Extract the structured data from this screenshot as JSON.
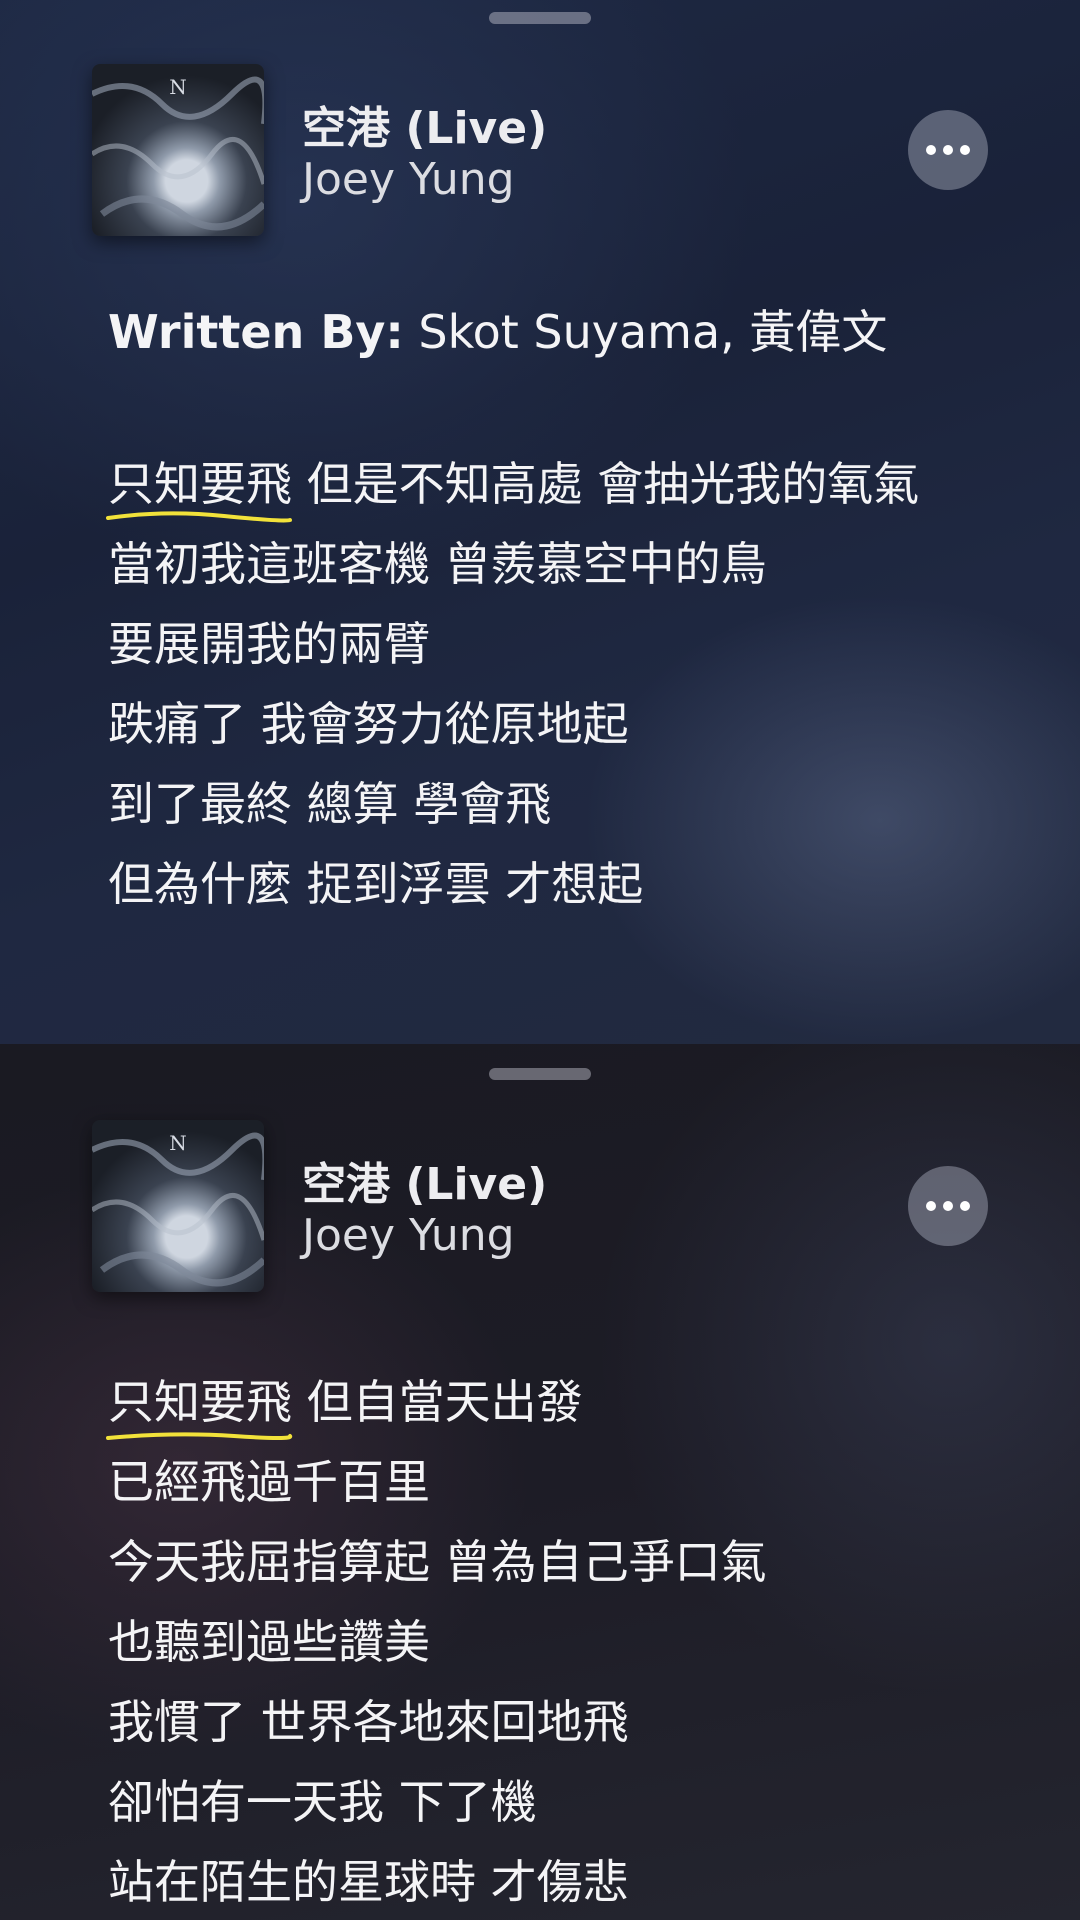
{
  "screens": [
    {
      "song": {
        "title": "空港 (Live)",
        "artist": "Joey Yung"
      },
      "credits": {
        "label": "Written By:",
        "value": " Skot Suyama, 黃偉文"
      },
      "first_line": {
        "highlight": "只知要飛",
        "rest": " 但是不知高處 會抽光我的氧氣"
      },
      "lines": [
        "當初我這班客機 曾羨慕空中的鳥",
        "要展開我的兩臂",
        "跌痛了 我會努力從原地起",
        "到了最終 總算 學會飛",
        "但為什麼 捉到浮雲 才想起"
      ]
    },
    {
      "song": {
        "title": "空港 (Live)",
        "artist": "Joey Yung"
      },
      "first_line": {
        "highlight": "只知要飛",
        "rest": " 但自當天出發"
      },
      "lines": [
        "已經飛過千百里",
        "今天我屈指算起 曾為自己爭口氣",
        "也聽到過些讚美",
        "我慣了 世界各地來回地飛",
        "卻怕有一天我 下了機",
        "站在陌生的星球時 才傷悲"
      ]
    }
  ],
  "icons": {
    "more": "ellipsis-icon"
  },
  "colors": {
    "highlight_underline": "#f2e23a",
    "top_panel": "#1e2944",
    "bottom_panel": "#1a1a22"
  }
}
